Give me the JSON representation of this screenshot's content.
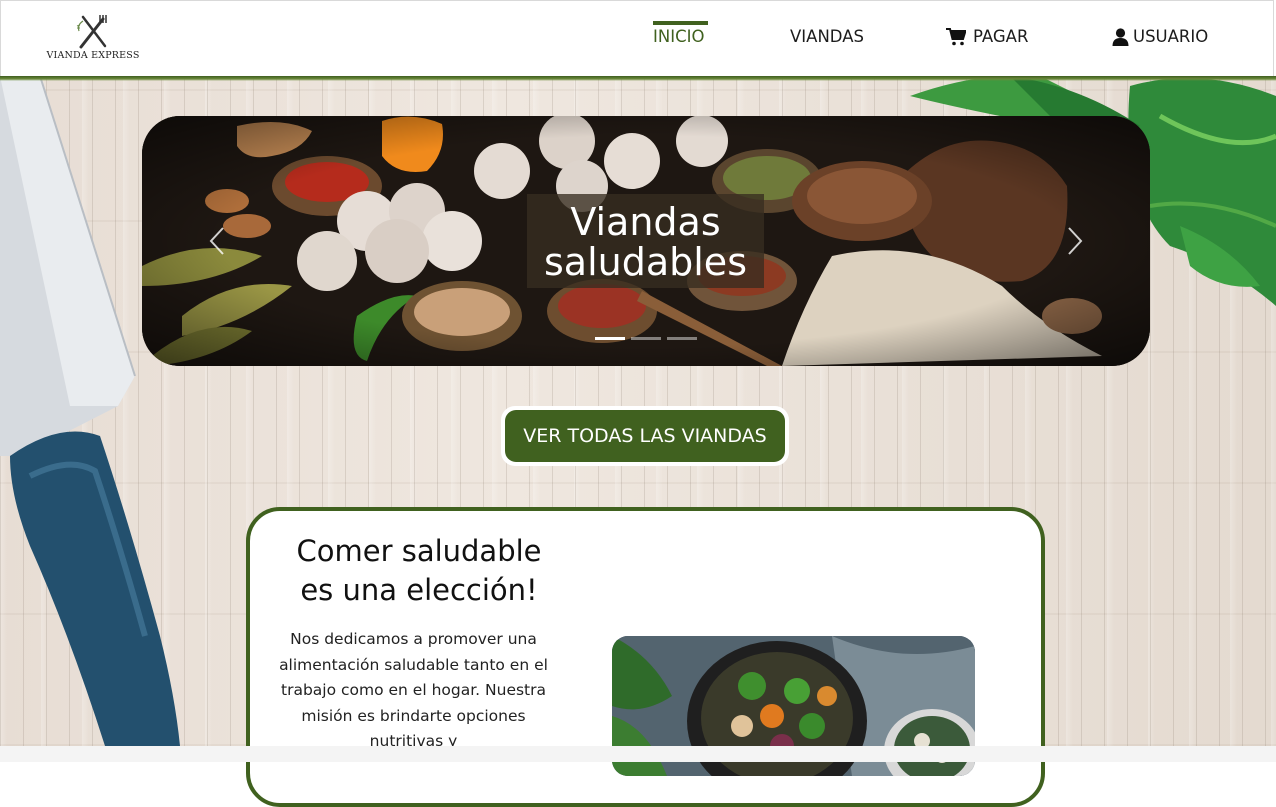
{
  "header": {
    "logo_text": "VIANDA EXPRESS",
    "nav": [
      {
        "label": "INICIO",
        "active": true
      },
      {
        "label": "VIANDAS",
        "active": false
      },
      {
        "label": "PAGAR",
        "icon": "cart-icon"
      },
      {
        "label": "USUARIO",
        "icon": "user-icon"
      }
    ]
  },
  "carousel": {
    "caption": "Viandas saludables",
    "slide_count": 3,
    "active_slide": 1
  },
  "cta": {
    "label": "VER TODAS LAS VIANDAS"
  },
  "card": {
    "title": "Comer saludable es una elección!",
    "text": "Nos dedicamos a promover una alimentación saludable tanto en el trabajo como en el hogar. Nuestra misión es brindarte opciones nutritivas y"
  },
  "colors": {
    "brand_green": "#40611f",
    "white": "#ffffff"
  }
}
